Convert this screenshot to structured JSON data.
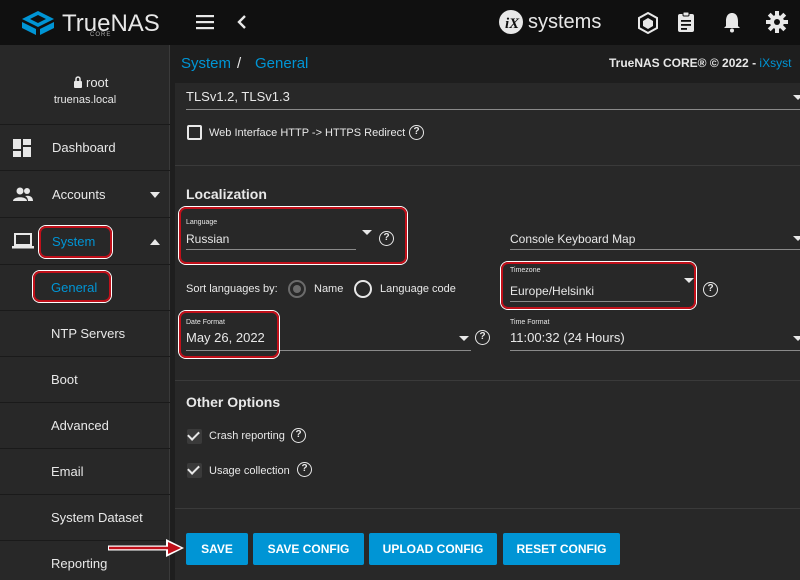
{
  "topbar": {
    "brand": "TrueNAS",
    "edition": "CORE",
    "vendor": "systems"
  },
  "sidebar": {
    "user": "root",
    "hostname": "truenas.local",
    "items": [
      {
        "label": "Dashboard",
        "icon": "dashboard-icon"
      },
      {
        "label": "Accounts",
        "icon": "accounts-icon"
      },
      {
        "label": "System",
        "icon": "laptop-icon"
      }
    ],
    "subitems": [
      "General",
      "NTP Servers",
      "Boot",
      "Advanced",
      "Email",
      "System Dataset",
      "Reporting"
    ]
  },
  "breadcrumb": {
    "parent": "System",
    "separator": "/",
    "current": "General",
    "copyright": "TrueNAS CORE® © 2022 - ",
    "copyright_link": "iXsyst"
  },
  "form": {
    "tls_value": "TLSv1.2, TLSv1.3",
    "https_redirect_label": "Web Interface HTTP -> HTTPS Redirect",
    "localization_title": "Localization",
    "language_label": "Language",
    "language_value": "Russian",
    "console_keyboard_placeholder": "Console Keyboard Map",
    "sort_label": "Sort languages by:",
    "sort_option_name": "Name",
    "sort_option_code": "Language code",
    "timezone_label": "Timezone",
    "timezone_value": "Europe/Helsinki",
    "date_format_label": "Date Format",
    "date_format_value": "May 26, 2022",
    "time_format_label": "Time Format",
    "time_format_value": "11:00:32 (24 Hours)",
    "other_title": "Other Options",
    "crash_reporting_label": "Crash reporting",
    "usage_collection_label": "Usage collection",
    "help_glyph": "?"
  },
  "buttons": {
    "save": "SAVE",
    "save_config": "SAVE CONFIG",
    "upload_config": "UPLOAD CONFIG",
    "reset_config": "RESET CONFIG"
  },
  "colors": {
    "accent": "#0095d5",
    "highlight_ring": "#c0101a",
    "topbar": "#101010",
    "card": "#282828"
  }
}
